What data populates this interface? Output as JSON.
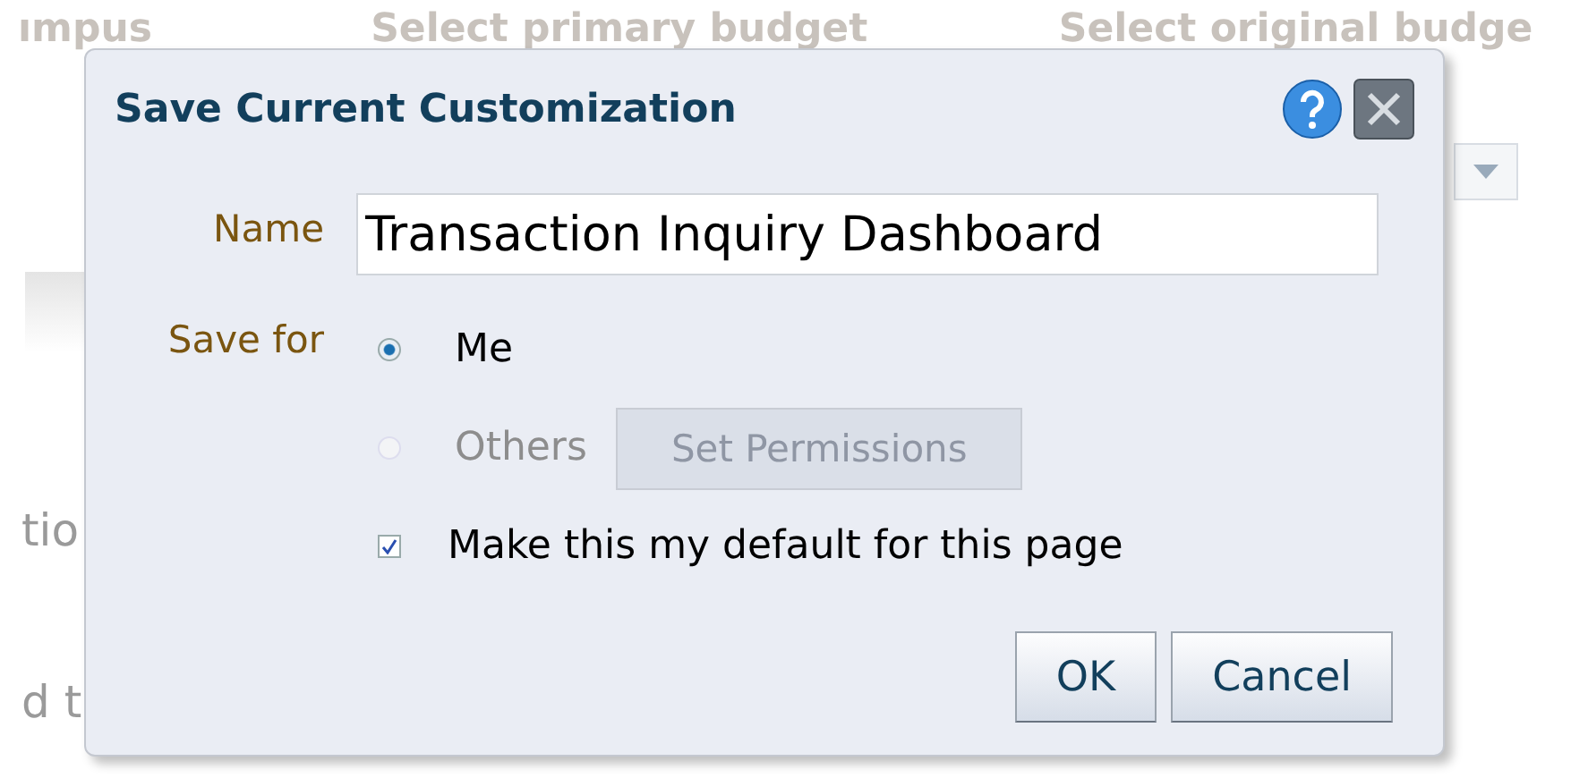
{
  "background": {
    "headers": [
      "ımpus",
      "Select primary budget",
      "Select original budge"
    ],
    "left_texts": [
      "tio",
      "d t"
    ]
  },
  "dialog": {
    "title": "Save Current Customization",
    "name_label": "Name",
    "name_value": "Transaction Inquiry Dashboard",
    "save_for_label": "Save for",
    "options": [
      {
        "label": "Me",
        "selected": true,
        "disabled": false
      },
      {
        "label": "Others",
        "selected": false,
        "disabled": true
      }
    ],
    "permissions_button": {
      "label": "Set Permissions",
      "disabled": true
    },
    "default_checkbox": {
      "label": "Make this my default for this page",
      "checked": true
    },
    "buttons": [
      "OK",
      "Cancel"
    ]
  }
}
